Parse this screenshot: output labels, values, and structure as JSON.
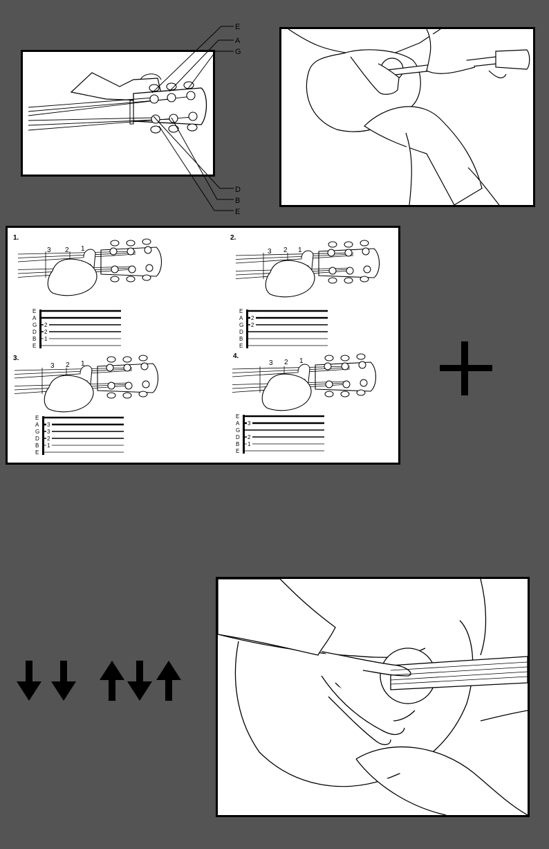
{
  "tuning_diagram": {
    "top_labels": [
      "E",
      "A",
      "G"
    ],
    "bottom_labels": [
      "D",
      "B",
      "E"
    ]
  },
  "chord_steps": [
    {
      "number": "1.",
      "fret_labels": [
        "3",
        "2",
        "1"
      ],
      "tab_strings": [
        "E",
        "A",
        "G",
        "D",
        "B",
        "E"
      ],
      "tab_frets": [
        "",
        "",
        "2",
        "2",
        "1",
        ""
      ]
    },
    {
      "number": "2.",
      "fret_labels": [
        "3",
        "2",
        "1"
      ],
      "tab_strings": [
        "E",
        "A",
        "G",
        "D",
        "B",
        "E"
      ],
      "tab_frets": [
        "",
        "2",
        "2",
        "",
        "",
        ""
      ]
    },
    {
      "number": "3.",
      "fret_labels": [
        "3",
        "2",
        "1"
      ],
      "tab_strings": [
        "E",
        "A",
        "G",
        "D",
        "B",
        "E"
      ],
      "tab_frets": [
        "",
        "3",
        "3",
        "2",
        "1",
        ""
      ]
    },
    {
      "number": "4.",
      "fret_labels": [
        "3",
        "2",
        "1"
      ],
      "tab_strings": [
        "E",
        "A",
        "G",
        "D",
        "B",
        "E"
      ],
      "tab_frets": [
        "",
        "3",
        "",
        "2",
        "1",
        ""
      ]
    }
  ],
  "strum_pattern": [
    "down",
    "down",
    "up",
    "down",
    "up"
  ],
  "colors": {
    "background": "#545454",
    "panel": "#ffffff",
    "ink": "#000000"
  }
}
